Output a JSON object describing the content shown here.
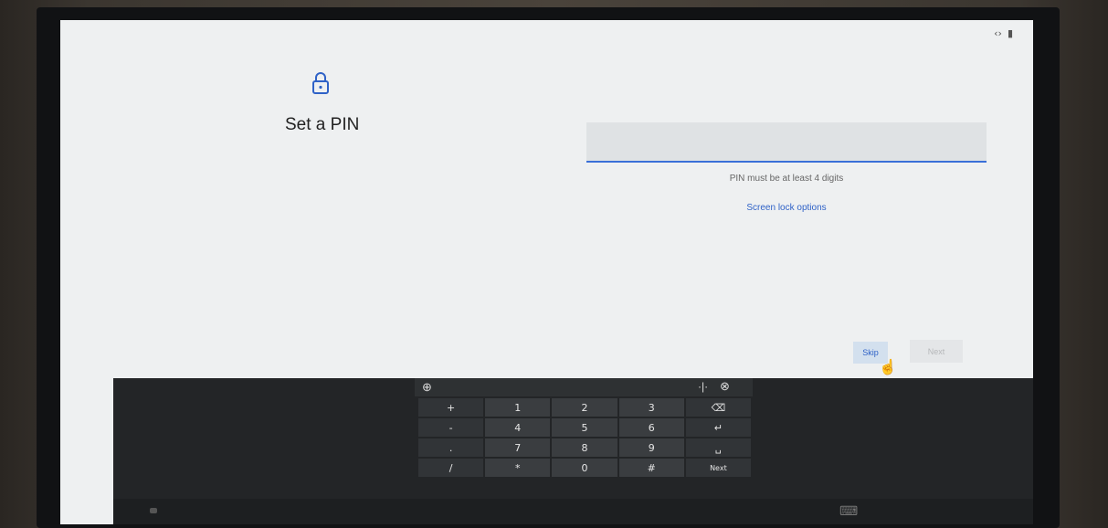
{
  "status": {
    "icons": [
      "code-icon",
      "battery-icon"
    ],
    "code_glyph": "‹›",
    "battery_glyph": "▮"
  },
  "setup": {
    "title": "Set a PIN",
    "pin_value": "",
    "hint": "PIN must be at least 4 digits",
    "screen_lock_options": "Screen lock options",
    "skip_label": "Skip",
    "next_label": "Next"
  },
  "keyboard": {
    "globe_glyph": "⊕",
    "move_glyph": "·|·",
    "close_glyph": "⊗",
    "keys": [
      [
        "+",
        "1",
        "2",
        "3",
        "⌫"
      ],
      [
        "-",
        "4",
        "5",
        "6",
        "↵"
      ],
      [
        ".",
        "7",
        "8",
        "9",
        "␣"
      ],
      [
        "/",
        "*",
        "0",
        "#",
        "Next"
      ]
    ]
  },
  "colors": {
    "accent": "#3a6fd8",
    "link": "#2f62c7",
    "keyboard_bg": "#232527"
  }
}
